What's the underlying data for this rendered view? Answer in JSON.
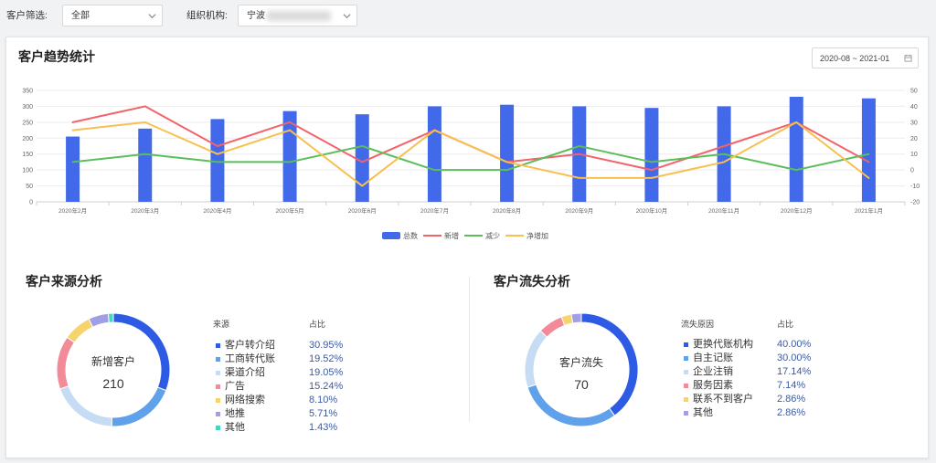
{
  "filters": {
    "customer": {
      "label": "客户筛选:",
      "value": "全部"
    },
    "org": {
      "label": "组织机构:",
      "value": "宁波"
    }
  },
  "trend_card": {
    "date_range": "2020-08 ~ 2021-01"
  },
  "icons": {
    "select": "chevron-down-icon",
    "date_picker": "calendar-icon"
  },
  "chart_data": [
    {
      "type": "bar",
      "title": "客户趋势统计",
      "categories": [
        "2020年2月",
        "2020年3月",
        "2020年4月",
        "2020年5月",
        "2020年6月",
        "2020年7月",
        "2020年8月",
        "2020年9月",
        "2020年10月",
        "2020年11月",
        "2020年12月",
        "2021年1月"
      ],
      "series": [
        {
          "name": "总数",
          "type": "bar",
          "y_axis": "left",
          "color": "#4169E9",
          "values": [
            205,
            230,
            260,
            285,
            275,
            300,
            305,
            300,
            295,
            300,
            330,
            325
          ]
        },
        {
          "name": "新增",
          "type": "line",
          "y_axis": "right",
          "color": "#F2636B",
          "values": [
            30,
            40,
            15,
            30,
            5,
            25,
            5,
            10,
            0,
            15,
            30,
            5
          ]
        },
        {
          "name": "减少",
          "type": "line",
          "y_axis": "right",
          "color": "#5BBE5B",
          "values": [
            5,
            10,
            5,
            5,
            15,
            0,
            0,
            15,
            5,
            10,
            0,
            10
          ]
        },
        {
          "name": "净增加",
          "type": "line",
          "y_axis": "right",
          "color": "#F7C04F",
          "values": [
            25,
            30,
            10,
            25,
            -10,
            25,
            5,
            -5,
            -5,
            5,
            30,
            -5
          ]
        }
      ],
      "y_left": {
        "range": [
          0,
          350
        ],
        "ticks": [
          0,
          50,
          100,
          150,
          200,
          250,
          300,
          350
        ]
      },
      "y_right": {
        "range": [
          -20,
          50
        ],
        "ticks": [
          -20,
          -10,
          0,
          10,
          20,
          30,
          40,
          50
        ]
      },
      "grid": true,
      "legend_position": "bottom"
    },
    {
      "type": "pie",
      "donut": true,
      "title": "客户来源分析",
      "center_label": "新增客户",
      "center_value": 210,
      "legend_headers": [
        "来源",
        "占比"
      ],
      "legend_position": "right",
      "slices": [
        {
          "label": "客户转介绍",
          "percent": 30.95,
          "color": "#2E5BE3"
        },
        {
          "label": "工商转代账",
          "percent": 19.52,
          "color": "#5FA1EB"
        },
        {
          "label": "渠道介绍",
          "percent": 19.05,
          "color": "#C6DCF4"
        },
        {
          "label": "广告",
          "percent": 15.24,
          "color": "#F28A98"
        },
        {
          "label": "网络搜索",
          "percent": 8.1,
          "color": "#F7D36E"
        },
        {
          "label": "地推",
          "percent": 5.71,
          "color": "#A09EE4"
        },
        {
          "label": "其他",
          "percent": 1.43,
          "color": "#47D3BE"
        }
      ]
    },
    {
      "type": "pie",
      "donut": true,
      "title": "客户流失分析",
      "center_label": "客户流失",
      "center_value": 70,
      "legend_headers": [
        "流失原因",
        "占比"
      ],
      "legend_position": "right",
      "slices": [
        {
          "label": "更换代账机构",
          "percent": 40.0,
          "color": "#2E5BE3"
        },
        {
          "label": "自主记账",
          "percent": 30.0,
          "color": "#5FA1EB"
        },
        {
          "label": "企业注销",
          "percent": 17.14,
          "color": "#C6DCF4"
        },
        {
          "label": "服务因素",
          "percent": 7.14,
          "color": "#F28A98"
        },
        {
          "label": "联系不到客户",
          "percent": 2.86,
          "color": "#F7D36E"
        },
        {
          "label": "其他",
          "percent": 2.86,
          "color": "#A09EE4"
        }
      ]
    }
  ]
}
